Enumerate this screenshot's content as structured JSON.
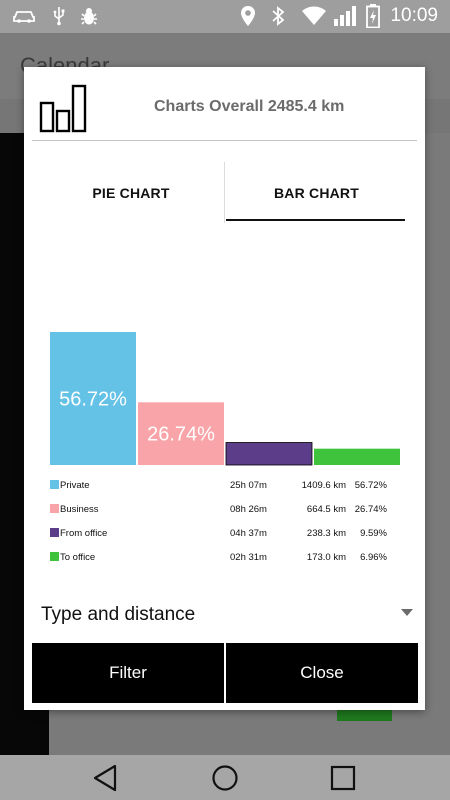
{
  "status_bar": {
    "time": "10:09",
    "icons": [
      "car-icon",
      "usb-icon",
      "bug-icon",
      "location-pin-icon",
      "bluetooth-icon",
      "wifi-icon",
      "signal-icon",
      "battery-charging-icon"
    ]
  },
  "background_app": {
    "title": "Calendar"
  },
  "dialog": {
    "title": "Charts Overall 2485.4 km",
    "tabs": [
      {
        "label": "PIE CHART",
        "selected": false
      },
      {
        "label": "BAR CHART",
        "selected": true
      }
    ],
    "legend": [
      {
        "name": "Private",
        "time": "25h 07m",
        "distance": "1409.6 km",
        "percent": "56.72%",
        "color": "#63c2e6"
      },
      {
        "name": "Business",
        "time": "08h 26m",
        "distance": "664.5 km",
        "percent": "26.74%",
        "color": "#f9a4a8"
      },
      {
        "name": "From office",
        "time": "04h 37m",
        "distance": "238.3 km",
        "percent": "9.59%",
        "color": "#5c3d8a"
      },
      {
        "name": "To office",
        "time": "02h 31m",
        "distance": "173.0 km",
        "percent": "6.96%",
        "color": "#3fc33d"
      }
    ],
    "dropdown": {
      "selected": "Type and distance"
    },
    "buttons": {
      "filter": "Filter",
      "close": "Close"
    }
  },
  "chart_data": {
    "type": "bar",
    "categories": [
      "Private",
      "Business",
      "From office",
      "To office"
    ],
    "values": [
      56.72,
      26.74,
      9.59,
      6.96
    ],
    "data_labels": [
      "56.72%",
      "26.74%",
      "",
      ""
    ],
    "colors": [
      "#63c2e6",
      "#f9a4a8",
      "#5c3d8a",
      "#3fc33d"
    ],
    "ylim": [
      0,
      56.72
    ],
    "grid": false,
    "legend": "bottom"
  },
  "nav_bar": {
    "buttons": [
      "back-icon",
      "home-icon",
      "recents-icon"
    ]
  }
}
